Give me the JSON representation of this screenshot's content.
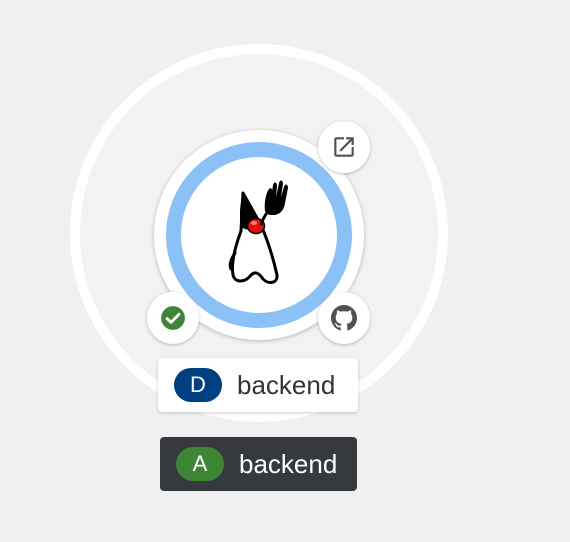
{
  "colors": {
    "background": "#f0f0f0",
    "node_ring": "#8bc1f7",
    "deployment_badge": "#004080",
    "application_badge": "#3e8635",
    "application_label_bg": "#36393d",
    "status_ok": "#3e8635"
  },
  "node": {
    "icon": "java-duke-icon",
    "decorators": {
      "top_right": "external-link-icon",
      "bottom_left": "check-circle-icon",
      "bottom_right": "github-icon"
    },
    "label": {
      "badge": "D",
      "text": "backend"
    }
  },
  "group": {
    "label": {
      "badge": "A",
      "text": "backend"
    }
  }
}
